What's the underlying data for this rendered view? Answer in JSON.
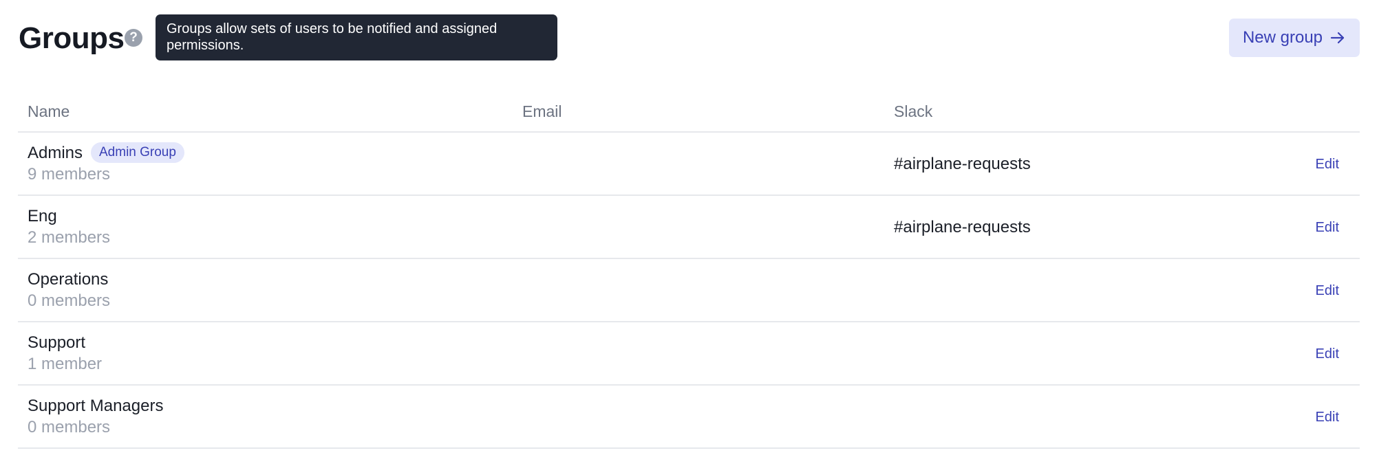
{
  "header": {
    "title": "Groups",
    "help_glyph": "?",
    "tooltip": "Groups allow sets of users to be notified and assigned permissions.",
    "new_group_label": "New group"
  },
  "table": {
    "columns": {
      "name": "Name",
      "email": "Email",
      "slack": "Slack"
    },
    "rows": [
      {
        "name": "Admins",
        "badge": "Admin Group",
        "members": "9 members",
        "email": "",
        "slack": "#airplane-requests",
        "action": "Edit"
      },
      {
        "name": "Eng",
        "badge": "",
        "members": "2 members",
        "email": "",
        "slack": "#airplane-requests",
        "action": "Edit"
      },
      {
        "name": "Operations",
        "badge": "",
        "members": "0 members",
        "email": "",
        "slack": "",
        "action": "Edit"
      },
      {
        "name": "Support",
        "badge": "",
        "members": "1 member",
        "email": "",
        "slack": "",
        "action": "Edit"
      },
      {
        "name": "Support Managers",
        "badge": "",
        "members": "0 members",
        "email": "",
        "slack": "",
        "action": "Edit"
      }
    ]
  },
  "colors": {
    "accent": "#3940b5",
    "accent_bg": "#e4e7fb",
    "tooltip_bg": "#212734",
    "muted_text": "#9ba1ad",
    "divider": "#e6e8ec"
  },
  "icons": {
    "help": "help-circle-icon",
    "new_group": "arrow-right-icon"
  }
}
